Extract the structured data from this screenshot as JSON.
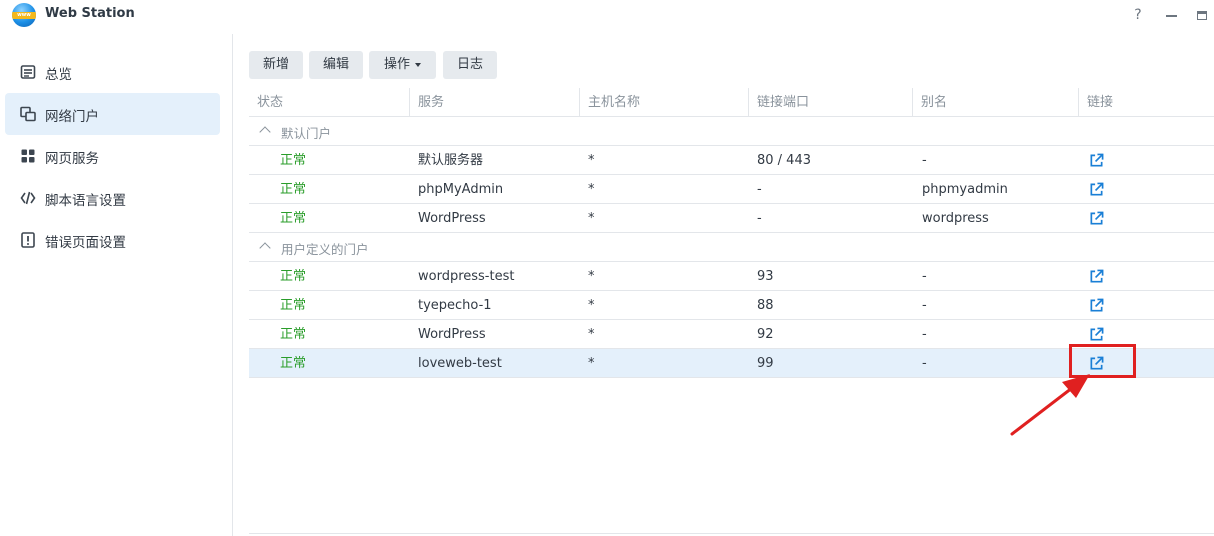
{
  "app": {
    "title": "Web Station",
    "logo_text": "www"
  },
  "window_controls": {
    "help": "?"
  },
  "sidebar": {
    "items": [
      {
        "label": "总览",
        "icon": "overview-icon",
        "active": false
      },
      {
        "label": "网络门户",
        "icon": "portal-icon",
        "active": true
      },
      {
        "label": "网页服务",
        "icon": "grid-icon",
        "active": false
      },
      {
        "label": "脚本语言设置",
        "icon": "code-icon",
        "active": false
      },
      {
        "label": "错误页面设置",
        "icon": "warning-icon",
        "active": false
      }
    ]
  },
  "toolbar": {
    "add_label": "新增",
    "edit_label": "编辑",
    "action_label": "操作",
    "log_label": "日志"
  },
  "table": {
    "columns": [
      "状态",
      "服务",
      "主机名称",
      "链接端口",
      "别名",
      "链接"
    ],
    "groups": [
      {
        "label": "默认门户",
        "rows": [
          {
            "status": "正常",
            "service": "默认服务器",
            "host": "*",
            "port": "80 / 443",
            "alias": "-"
          },
          {
            "status": "正常",
            "service": "phpMyAdmin",
            "host": "*",
            "port": "-",
            "alias": "phpmyadmin"
          },
          {
            "status": "正常",
            "service": "WordPress",
            "host": "*",
            "port": "-",
            "alias": "wordpress"
          }
        ]
      },
      {
        "label": "用户定义的门户",
        "rows": [
          {
            "status": "正常",
            "service": "wordpress-test",
            "host": "*",
            "port": "93",
            "alias": "-"
          },
          {
            "status": "正常",
            "service": "tyepecho-1",
            "host": "*",
            "port": "88",
            "alias": "-"
          },
          {
            "status": "正常",
            "service": "WordPress",
            "host": "*",
            "port": "92",
            "alias": "-"
          },
          {
            "status": "正常",
            "service": "loveweb-test",
            "host": "*",
            "port": "99",
            "alias": "-",
            "selected": true
          }
        ]
      }
    ]
  },
  "colors": {
    "accent": "#1a7fd6",
    "status_ok": "#2a9d2a",
    "annotation": "#e02020",
    "selected_row": "#e4f0fb"
  }
}
